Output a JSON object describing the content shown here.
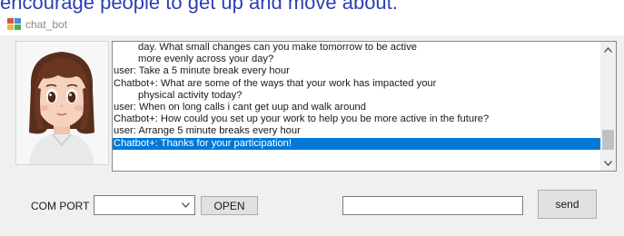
{
  "caption": "encourage people to get up and move about.",
  "window": {
    "title": "chat_bot",
    "icon": "app-window-icon"
  },
  "avatar": {
    "icon": "cartoon-girl-avatar"
  },
  "chat": {
    "lines": [
      {
        "text": "day. What small changes can you make tomorrow to be active",
        "indent": true,
        "selected": false
      },
      {
        "text": "more evenly across your day?",
        "indent": true,
        "selected": false
      },
      {
        "text": "user: Take a 5 minute break every hour",
        "indent": false,
        "selected": false
      },
      {
        "text": "Chatbot+:  What are some of the ways that your work has impacted your",
        "indent": false,
        "selected": false
      },
      {
        "text": "physical activity today?",
        "indent": true,
        "selected": false
      },
      {
        "text": "user: When on long calls i cant get uup and walk around",
        "indent": false,
        "selected": false
      },
      {
        "text": "Chatbot+:  How could you set up your work to help you be more active in the future?",
        "indent": false,
        "selected": false
      },
      {
        "text": "user: Arrange 5 minute breaks every hour",
        "indent": false,
        "selected": false
      },
      {
        "text": "Chatbot+:  Thanks for your participation!",
        "indent": false,
        "selected": true
      }
    ],
    "scroll_up_icon": "scroll-up-arrow-icon",
    "scroll_down_icon": "scroll-down-arrow-icon"
  },
  "controls": {
    "com_port_label": "COM PORT",
    "com_port_value": "",
    "dropdown_icon": "chevron-down-icon",
    "open_label": "OPEN",
    "message_value": "",
    "send_label": "send"
  },
  "colors": {
    "selection": "#0078d7",
    "caption": "#2b3fb5",
    "window_bg": "#f0f0f0"
  }
}
